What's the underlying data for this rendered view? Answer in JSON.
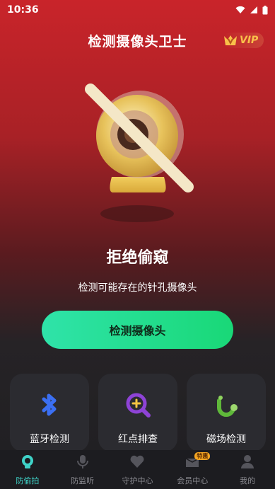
{
  "status_bar": {
    "time": "10:36"
  },
  "header": {
    "title": "检测摄像头卫士",
    "vip_label": "VIP"
  },
  "hero": {
    "title": "拒绝偷窥",
    "subtitle": "检测可能存在的针孔摄像头"
  },
  "cta": {
    "label": "检测摄像头"
  },
  "tools": [
    {
      "label": "蓝牙检测",
      "icon": "bluetooth-icon"
    },
    {
      "label": "红点排查",
      "icon": "red-dot-search-icon"
    },
    {
      "label": "磁场检测",
      "icon": "magnet-icon"
    }
  ],
  "tabs": [
    {
      "label": "防偷拍",
      "icon": "camera-icon",
      "active": true
    },
    {
      "label": "防监听",
      "icon": "microphone-icon"
    },
    {
      "label": "守护中心",
      "icon": "heart-icon"
    },
    {
      "label": "会员中心",
      "icon": "member-icon",
      "badge": "特惠"
    },
    {
      "label": "我的",
      "icon": "person-icon"
    }
  ],
  "colors": {
    "accent": "#3fd3c8",
    "cta": "#19d877",
    "vip": "#f9c04a"
  }
}
